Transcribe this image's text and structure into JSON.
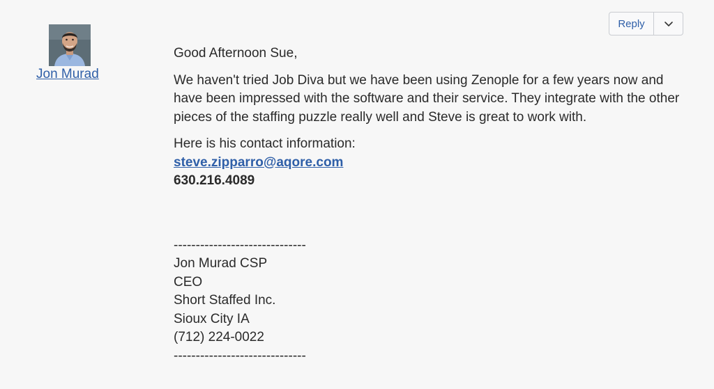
{
  "author": {
    "name": "Jon Murad",
    "avatar_icon": "user-avatar-photo"
  },
  "actions": {
    "reply_label": "Reply",
    "menu_icon": "chevron-down-icon"
  },
  "message": {
    "greeting": "Good Afternoon Sue,",
    "body": "We haven't tried Job Diva but we have been using Zenople for a few years now and have been impressed with the software and their service. They integrate with the other pieces of the staffing puzzle really well and Steve is great to work with.",
    "contact_intro": "Here is his contact information:",
    "contact_email": "steve.zipparro@aqore.com",
    "contact_phone": "630.216.4089"
  },
  "signature": {
    "divider_top": "------------------------------",
    "name": "Jon Murad CSP",
    "title": "CEO",
    "company": "Short Staffed Inc.",
    "location": "Sioux City IA",
    "phone": "(712) 224-0022",
    "divider_bottom": "------------------------------"
  },
  "colors": {
    "link": "#2f5fa8",
    "background": "#f7f7f7",
    "text": "#2a2a2a"
  }
}
